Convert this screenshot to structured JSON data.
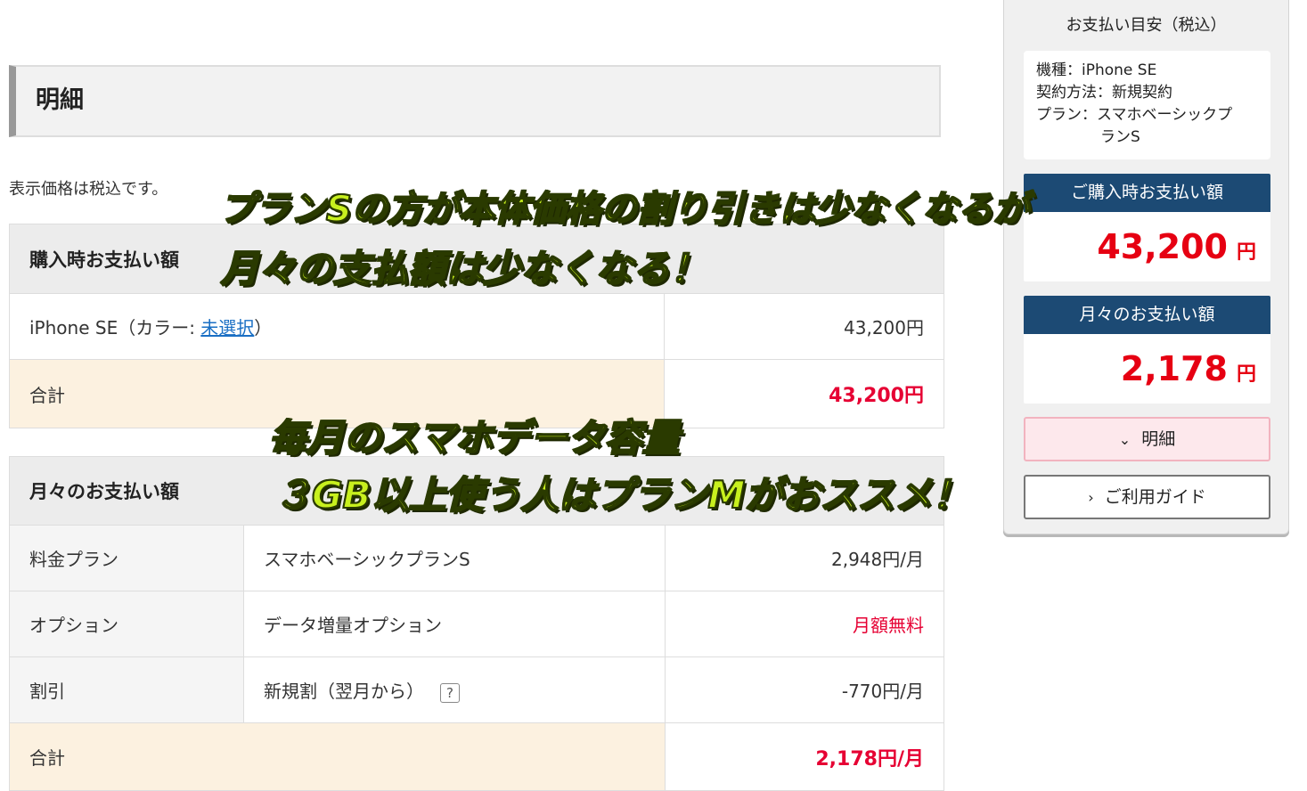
{
  "section": {
    "title": "明細",
    "note": "表示価格は税込です。"
  },
  "purchase": {
    "heading": "購入時お支払い額",
    "item_label_prefix": "iPhone SE（カラー: ",
    "item_color_link": "未選択",
    "item_label_suffix": "）",
    "item_price": "43,200円",
    "total_label": "合計",
    "total_value": "43,200円"
  },
  "monthly": {
    "heading": "月々のお支払い額",
    "rows": [
      {
        "label": "料金プラン",
        "name": "スマホベーシックプランS",
        "value": "2,948円/月"
      },
      {
        "label": "オプション",
        "name": "データ増量オプション",
        "value": "月額無料"
      },
      {
        "label": "割引",
        "name": "新規割（翌月から）",
        "value": "-770円/月",
        "help": "?"
      }
    ],
    "total_label": "合計",
    "total_value": "2,178円/月"
  },
  "panel": {
    "title": "お支払い目安（税込）",
    "device_line": "機種：iPhone SE",
    "contract_line": "契約方法：新規契約",
    "plan_line_1": "プラン：スマホベーシックプ",
    "plan_line_2": "ランS",
    "purchase_bar": "ご購入時お支払い額",
    "purchase_amount": "43,200",
    "yen": "円",
    "monthly_bar": "月々のお支払い額",
    "monthly_amount": "2,178",
    "detail_button": "明細",
    "guide_button": "ご利用ガイド",
    "chevron_down": "⌄",
    "chevron_right": "›"
  },
  "captions": {
    "line1": "プランSの方が本体価格の割り引きは少なくなるが",
    "line2": "月々の支払額は少なくなる！",
    "line3": "毎月のスマホデータ容量",
    "line4": "３GB以上使う人はプランMがおススメ！"
  },
  "colors": {
    "accent_red": "#e60033",
    "panel_bar": "#1c4a74",
    "caption_fill": "#c8f01e"
  }
}
